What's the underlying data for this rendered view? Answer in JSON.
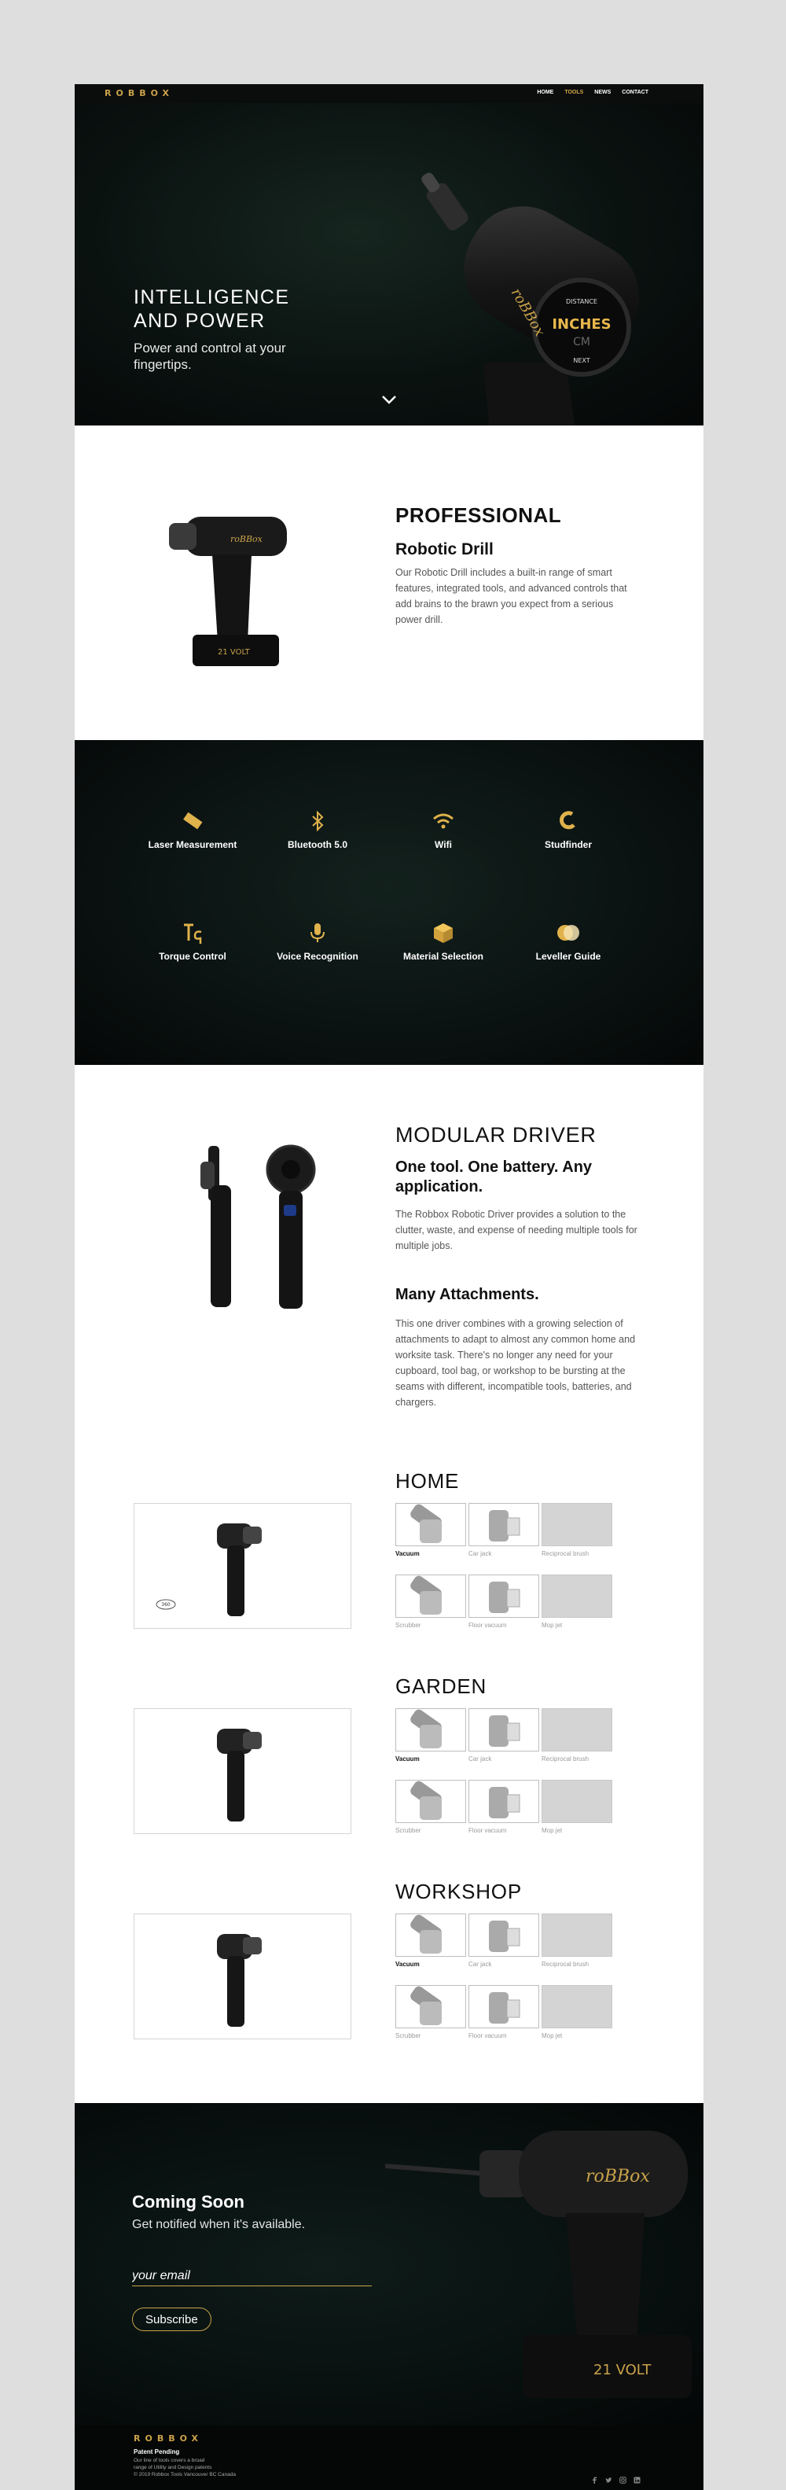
{
  "nav": {
    "logo": "ROBBOX",
    "items": [
      "HOME",
      "TOOLS",
      "NEWS",
      "CONTACT"
    ],
    "active_index": 1,
    "active_color": "#d4a94a"
  },
  "hero": {
    "title": "INTELLIGENCE\nAND POWER",
    "subtitle": "Power and control at your fingertips.",
    "screen": {
      "top": "DISTANCE",
      "main": "INCHES",
      "second": "CM",
      "bottom": "NEXT"
    },
    "brand": "roBBox"
  },
  "professional": {
    "heading": "PROFESSIONAL",
    "subheading": "Robotic Drill",
    "text": "Our Robotic Drill includes a built-in range of smart features, integrated tools, and advanced controls that add brains to the brawn you expect from a serious power drill.",
    "battery": "21 VOLT"
  },
  "features": [
    {
      "label": "Laser Measurement",
      "icon": "ruler-icon"
    },
    {
      "label": "Bluetooth 5.0",
      "icon": "bluetooth-icon"
    },
    {
      "label": "Wifi",
      "icon": "wifi-icon"
    },
    {
      "label": "Studfinder",
      "icon": "magnet-icon"
    },
    {
      "label": "Torque Control",
      "icon": "torque-icon"
    },
    {
      "label": "Voice Recognition",
      "icon": "microphone-icon"
    },
    {
      "label": "Material Selection",
      "icon": "cube-icon"
    },
    {
      "label": "Leveller Guide",
      "icon": "leveller-icon"
    }
  ],
  "modular": {
    "heading": "MODULAR DRIVER",
    "tagline": "One tool. One battery. Any application.",
    "text1": "The Robbox Robotic Driver provides a solution to the clutter, waste, and expense of needing multiple tools for multiple jobs.",
    "subheading2": "Many Attachments.",
    "text2": "This one driver combines with a growing selection of attachments to adapt to almost any common home and worksite task. There's no longer any need for your cupboard, tool bag, or workshop to be bursting at the seams with different, incompatible tools, batteries, and chargers."
  },
  "categories": [
    {
      "title": "HOME",
      "badge": "360"
    },
    {
      "title": "GARDEN"
    },
    {
      "title": "WORKSHOP"
    }
  ],
  "attachments": [
    "Vacuum",
    "Car jack",
    "Reciprocal brush",
    "Scrubber",
    "Floor vacuum",
    "Mop jet"
  ],
  "coming_soon": {
    "title": "Coming Soon",
    "subtitle": "Get notified when it's available.",
    "email_placeholder": "your email",
    "button": "Subscribe",
    "battery": "21 VOLT",
    "brand": "roBBox"
  },
  "footer": {
    "logo": "ROBBOX",
    "patent": "Patent Pending",
    "lines": [
      "Our line of tools covers a broad",
      "range of Utility and Design patents",
      "© 2019 Robbox Tools Vancouver BC Canada"
    ],
    "social": [
      "facebook-icon",
      "twitter-icon",
      "instagram-icon",
      "linkedin-icon"
    ]
  },
  "colors": {
    "accent": "#c9a24a",
    "dark": "#0a1210"
  }
}
